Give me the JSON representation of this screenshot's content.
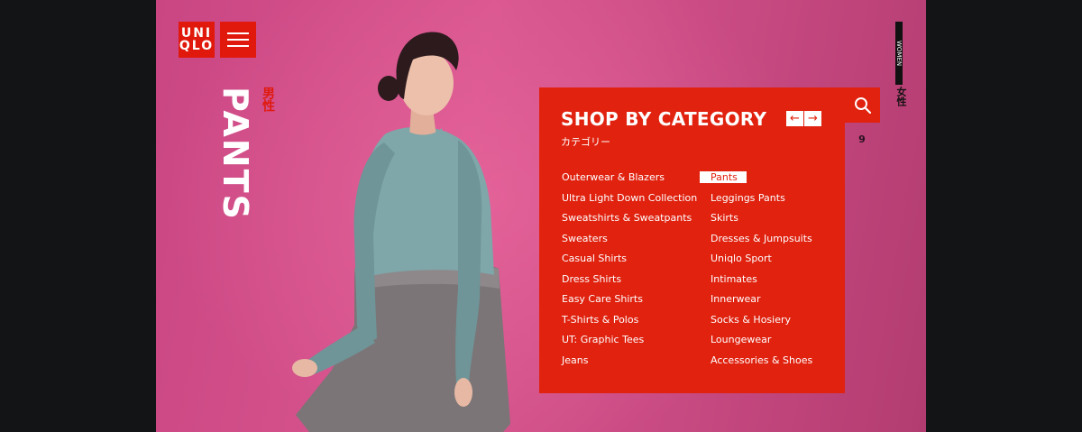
{
  "brand": {
    "logo_line1": "UNI",
    "logo_line2": "QLO"
  },
  "hero": {
    "title": "PANTS",
    "title_jp": "男性"
  },
  "category_panel": {
    "title": "SHOP BY CATEGORY",
    "subtitle": "カテゴリー",
    "prev_arrow": "←",
    "next_arrow": "→",
    "left_column": [
      "Outerwear & Blazers",
      "Ultra Light Down Collection",
      "Sweatshirts & Sweatpants",
      "Sweaters",
      "Casual Shirts",
      "Dress Shirts",
      "Easy Care Shirts",
      "T-Shirts & Polos",
      "UT: Graphic Tees",
      "Jeans"
    ],
    "right_column": [
      "Pants",
      "Leggings Pants",
      "Skirts",
      "Dresses & Jumpsuits",
      "Uniqlo Sport",
      "Intimates",
      "Innerwear",
      "Socks & Hosiery",
      "Loungewear",
      "Accessories & Shoes"
    ],
    "active_item": "Pants"
  },
  "side": {
    "page_number": "9",
    "women_label": "WOMEN",
    "women_jp": "女性"
  },
  "colors": {
    "brand_red": "#e0220f",
    "background_pink": "#d3538c",
    "frame": "#131415"
  },
  "icons": {
    "menu": "hamburger-icon",
    "search": "search-icon"
  }
}
